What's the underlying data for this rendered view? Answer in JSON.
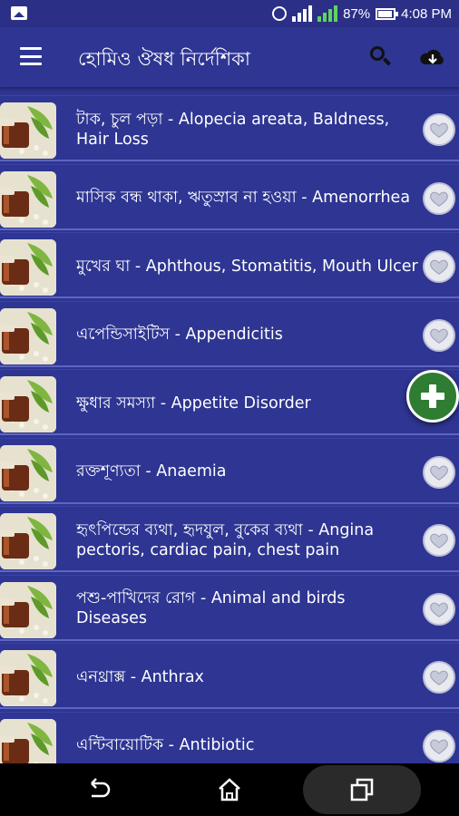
{
  "status_bar": {
    "battery_percent": "87%",
    "time": "4:08 PM"
  },
  "app_bar": {
    "title": "হোমিও ঔষধ নির্দেশিকা",
    "icons": [
      "menu-icon",
      "search-icon",
      "cloud-download-icon"
    ]
  },
  "items": [
    {
      "title": "টাক, চুল পড়া - Alopecia areata, Baldness, Hair Loss"
    },
    {
      "title": "মাসিক বন্ধ থাকা, ঋতুস্রাব না হওয়া - Amenorrhea"
    },
    {
      "title": "মুখের ঘা - Aphthous, Stomatitis, Mouth Ulcer"
    },
    {
      "title": "এপেন্ডিসাইটিস - Appendicitis"
    },
    {
      "title": "ক্ষুধার সমস্যা - Appetite Disorder"
    },
    {
      "title": "রক্তশূণ্যতা - Anaemia"
    },
    {
      "title": "হৃৎপিন্ডের ব্যথা, হৃদযুল, বুকের ব্যথা - Angina pectoris, cardiac pain, chest pain"
    },
    {
      "title": "পশু-পাখিদের রোগ - Animal and birds Diseases"
    },
    {
      "title": "এনথ্রাক্স - Anthrax"
    },
    {
      "title": "এন্টিবায়োটিক - Antibiotic"
    }
  ],
  "colors": {
    "primary": "#2e3592",
    "divider": "#5f66c2",
    "fab": "#2e7d32"
  }
}
